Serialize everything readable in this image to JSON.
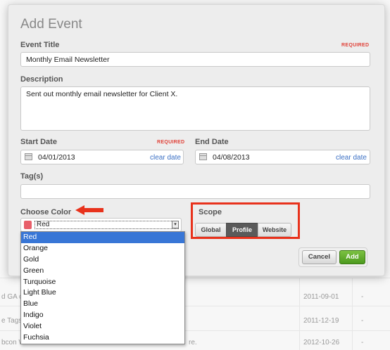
{
  "background": {
    "rows": [
      {
        "left": "d GA co",
        "date": "2011-09-01",
        "dash": "-"
      },
      {
        "left": "e Tags",
        "date": "2011-12-19",
        "dash": "-"
      },
      {
        "left": "bcon W",
        "date": "2012-10-26",
        "dash": "-",
        "extra": "re."
      }
    ]
  },
  "modal": {
    "title": "Add Event",
    "event_title": {
      "label": "Event Title",
      "required": "REQUIRED",
      "value": "Monthly Email Newsletter"
    },
    "description": {
      "label": "Description",
      "value": "Sent out monthly email newsletter for Client X."
    },
    "start_date": {
      "label": "Start Date",
      "required": "REQUIRED",
      "value": "04/01/2013",
      "clear": "clear date"
    },
    "end_date": {
      "label": "End Date",
      "value": "04/08/2013",
      "clear": "clear date"
    },
    "tags": {
      "label": "Tag(s)",
      "value": ""
    },
    "color": {
      "label": "Choose Color",
      "selected": "Red",
      "swatch": "#e85f6a",
      "options": [
        "Red",
        "Orange",
        "Gold",
        "Green",
        "Turquoise",
        "Light Blue",
        "Blue",
        "Indigo",
        "Violet",
        "Fuchsia"
      ]
    },
    "scope": {
      "label": "Scope",
      "options": [
        "Global",
        "Profile",
        "Website"
      ],
      "selected": "Profile"
    },
    "buttons": {
      "cancel": "Cancel",
      "add": "Add"
    }
  },
  "colors": {
    "accent_red": "#e8321c",
    "add_green": "#5aa82a",
    "link_blue": "#3a6fc4",
    "select_blue": "#3876d6"
  }
}
